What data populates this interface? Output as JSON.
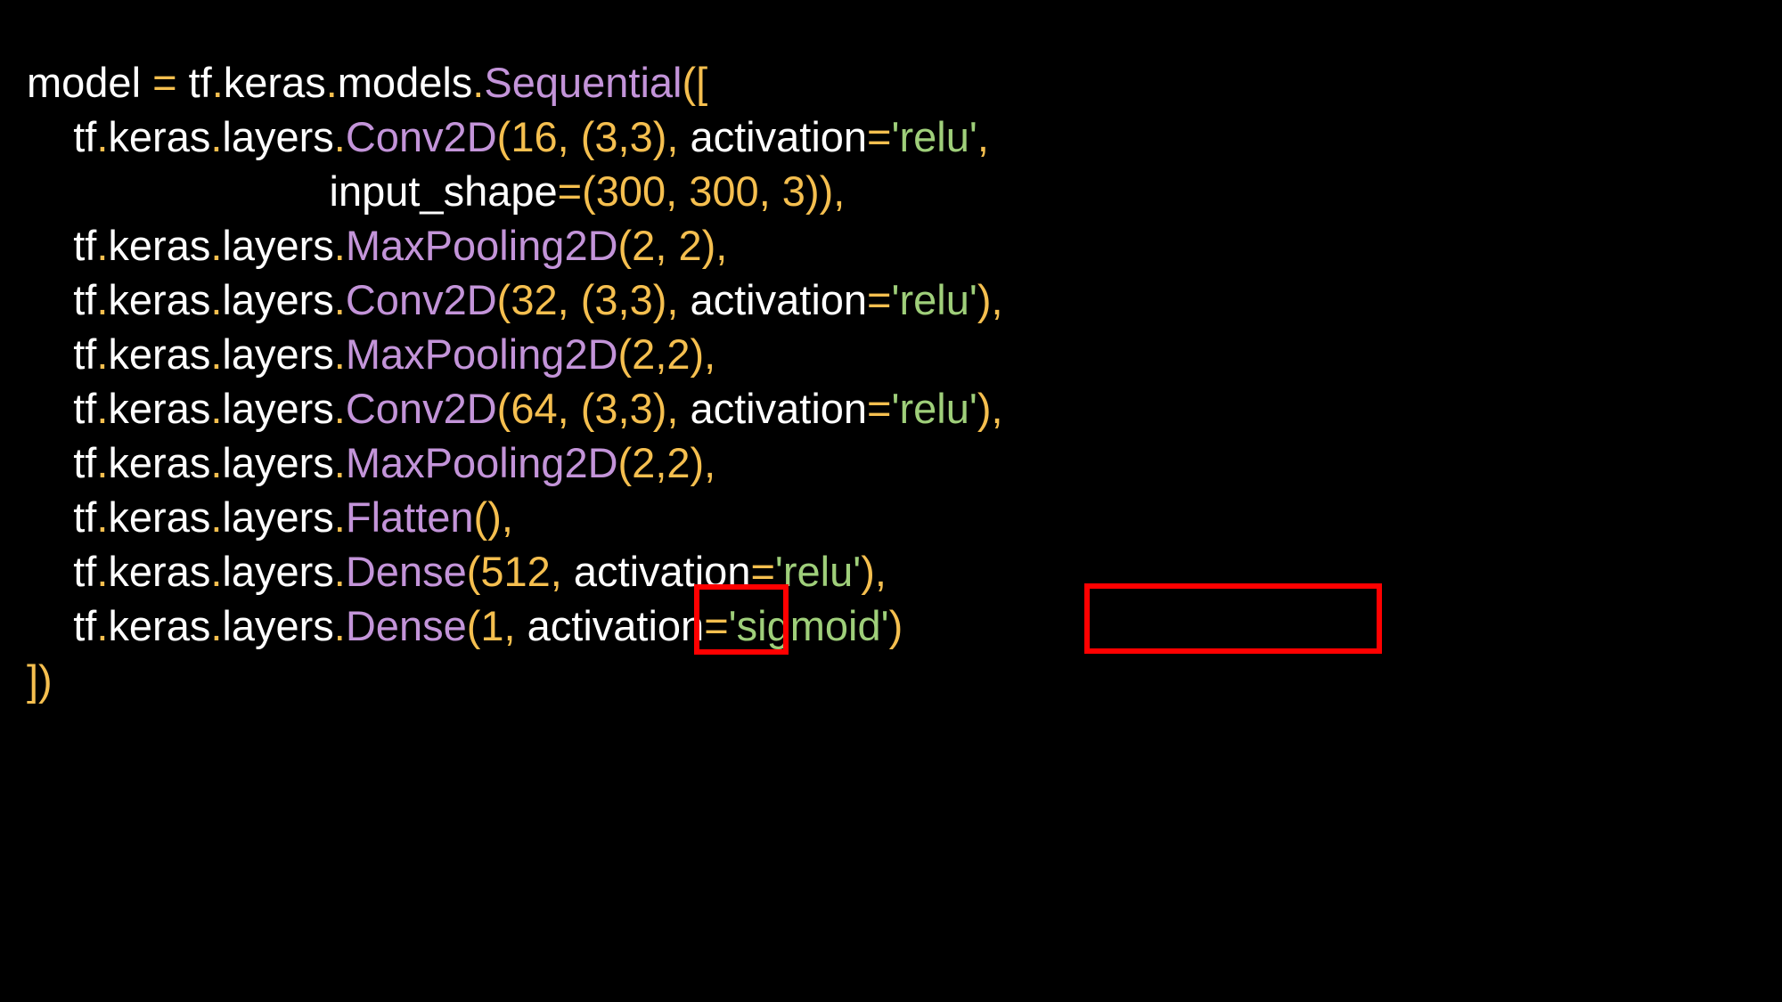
{
  "colors": {
    "background": "#000000",
    "text": "#ffffff",
    "operator": "#f5bf4f",
    "function": "#c394d9",
    "string": "#9fcf7a",
    "highlight_box": "#ff0000"
  },
  "code": {
    "lines": [
      {
        "indent": "",
        "tokens": [
          {
            "text": "model ",
            "kind": "text"
          },
          {
            "text": "=",
            "kind": "operator"
          },
          {
            "text": " tf",
            "kind": "text"
          },
          {
            "text": ".",
            "kind": "operator"
          },
          {
            "text": "keras",
            "kind": "text"
          },
          {
            "text": ".",
            "kind": "operator"
          },
          {
            "text": "models",
            "kind": "text"
          },
          {
            "text": ".",
            "kind": "operator"
          },
          {
            "text": "Sequential",
            "kind": "function"
          },
          {
            "text": "([",
            "kind": "operator"
          }
        ]
      },
      {
        "indent": "    ",
        "tokens": [
          {
            "text": "tf",
            "kind": "text"
          },
          {
            "text": ".",
            "kind": "operator"
          },
          {
            "text": "keras",
            "kind": "text"
          },
          {
            "text": ".",
            "kind": "operator"
          },
          {
            "text": "layers",
            "kind": "text"
          },
          {
            "text": ".",
            "kind": "operator"
          },
          {
            "text": "Conv2D",
            "kind": "function"
          },
          {
            "text": "(16, (3,3), ",
            "kind": "operator"
          },
          {
            "text": "activation",
            "kind": "text"
          },
          {
            "text": "=",
            "kind": "operator"
          },
          {
            "text": "'relu'",
            "kind": "string"
          },
          {
            "text": ",",
            "kind": "operator"
          }
        ]
      },
      {
        "indent": "                          ",
        "tokens": [
          {
            "text": "input_shape",
            "kind": "text"
          },
          {
            "text": "=(300, 300, 3)),",
            "kind": "operator"
          }
        ]
      },
      {
        "indent": "    ",
        "tokens": [
          {
            "text": "tf",
            "kind": "text"
          },
          {
            "text": ".",
            "kind": "operator"
          },
          {
            "text": "keras",
            "kind": "text"
          },
          {
            "text": ".",
            "kind": "operator"
          },
          {
            "text": "layers",
            "kind": "text"
          },
          {
            "text": ".",
            "kind": "operator"
          },
          {
            "text": "MaxPooling2D",
            "kind": "function"
          },
          {
            "text": "(2, 2),",
            "kind": "operator"
          }
        ]
      },
      {
        "indent": "    ",
        "tokens": [
          {
            "text": "tf",
            "kind": "text"
          },
          {
            "text": ".",
            "kind": "operator"
          },
          {
            "text": "keras",
            "kind": "text"
          },
          {
            "text": ".",
            "kind": "operator"
          },
          {
            "text": "layers",
            "kind": "text"
          },
          {
            "text": ".",
            "kind": "operator"
          },
          {
            "text": "Conv2D",
            "kind": "function"
          },
          {
            "text": "(32, (3,3), ",
            "kind": "operator"
          },
          {
            "text": "activation",
            "kind": "text"
          },
          {
            "text": "=",
            "kind": "operator"
          },
          {
            "text": "'relu'",
            "kind": "string"
          },
          {
            "text": "),",
            "kind": "operator"
          }
        ]
      },
      {
        "indent": "    ",
        "tokens": [
          {
            "text": "tf",
            "kind": "text"
          },
          {
            "text": ".",
            "kind": "operator"
          },
          {
            "text": "keras",
            "kind": "text"
          },
          {
            "text": ".",
            "kind": "operator"
          },
          {
            "text": "layers",
            "kind": "text"
          },
          {
            "text": ".",
            "kind": "operator"
          },
          {
            "text": "MaxPooling2D",
            "kind": "function"
          },
          {
            "text": "(2,2),",
            "kind": "operator"
          }
        ]
      },
      {
        "indent": "    ",
        "tokens": [
          {
            "text": "tf",
            "kind": "text"
          },
          {
            "text": ".",
            "kind": "operator"
          },
          {
            "text": "keras",
            "kind": "text"
          },
          {
            "text": ".",
            "kind": "operator"
          },
          {
            "text": "layers",
            "kind": "text"
          },
          {
            "text": ".",
            "kind": "operator"
          },
          {
            "text": "Conv2D",
            "kind": "function"
          },
          {
            "text": "(64, (3,3), ",
            "kind": "operator"
          },
          {
            "text": "activation",
            "kind": "text"
          },
          {
            "text": "=",
            "kind": "operator"
          },
          {
            "text": "'relu'",
            "kind": "string"
          },
          {
            "text": "),",
            "kind": "operator"
          }
        ]
      },
      {
        "indent": "    ",
        "tokens": [
          {
            "text": "tf",
            "kind": "text"
          },
          {
            "text": ".",
            "kind": "operator"
          },
          {
            "text": "keras",
            "kind": "text"
          },
          {
            "text": ".",
            "kind": "operator"
          },
          {
            "text": "layers",
            "kind": "text"
          },
          {
            "text": ".",
            "kind": "operator"
          },
          {
            "text": "MaxPooling2D",
            "kind": "function"
          },
          {
            "text": "(2,2),",
            "kind": "operator"
          }
        ]
      },
      {
        "indent": "    ",
        "tokens": [
          {
            "text": "tf",
            "kind": "text"
          },
          {
            "text": ".",
            "kind": "operator"
          },
          {
            "text": "keras",
            "kind": "text"
          },
          {
            "text": ".",
            "kind": "operator"
          },
          {
            "text": "layers",
            "kind": "text"
          },
          {
            "text": ".",
            "kind": "operator"
          },
          {
            "text": "Flatten",
            "kind": "function"
          },
          {
            "text": "(),",
            "kind": "operator"
          }
        ]
      },
      {
        "indent": "    ",
        "tokens": [
          {
            "text": "tf",
            "kind": "text"
          },
          {
            "text": ".",
            "kind": "operator"
          },
          {
            "text": "keras",
            "kind": "text"
          },
          {
            "text": ".",
            "kind": "operator"
          },
          {
            "text": "layers",
            "kind": "text"
          },
          {
            "text": ".",
            "kind": "operator"
          },
          {
            "text": "Dense",
            "kind": "function"
          },
          {
            "text": "(512, ",
            "kind": "operator"
          },
          {
            "text": "activation",
            "kind": "text"
          },
          {
            "text": "=",
            "kind": "operator"
          },
          {
            "text": "'relu'",
            "kind": "string"
          },
          {
            "text": "),",
            "kind": "operator"
          }
        ]
      },
      {
        "indent": "    ",
        "tokens": [
          {
            "text": "tf",
            "kind": "text"
          },
          {
            "text": ".",
            "kind": "operator"
          },
          {
            "text": "keras",
            "kind": "text"
          },
          {
            "text": ".",
            "kind": "operator"
          },
          {
            "text": "layers",
            "kind": "text"
          },
          {
            "text": ".",
            "kind": "operator"
          },
          {
            "text": "Dense",
            "kind": "function"
          },
          {
            "text": "(1, ",
            "kind": "operator"
          },
          {
            "text": "activation",
            "kind": "text"
          },
          {
            "text": "=",
            "kind": "operator"
          },
          {
            "text": "'sigmoid'",
            "kind": "string"
          },
          {
            "text": ")",
            "kind": "operator"
          }
        ]
      },
      {
        "indent": "",
        "tokens": [
          {
            "text": "])",
            "kind": "operator"
          }
        ]
      }
    ]
  }
}
